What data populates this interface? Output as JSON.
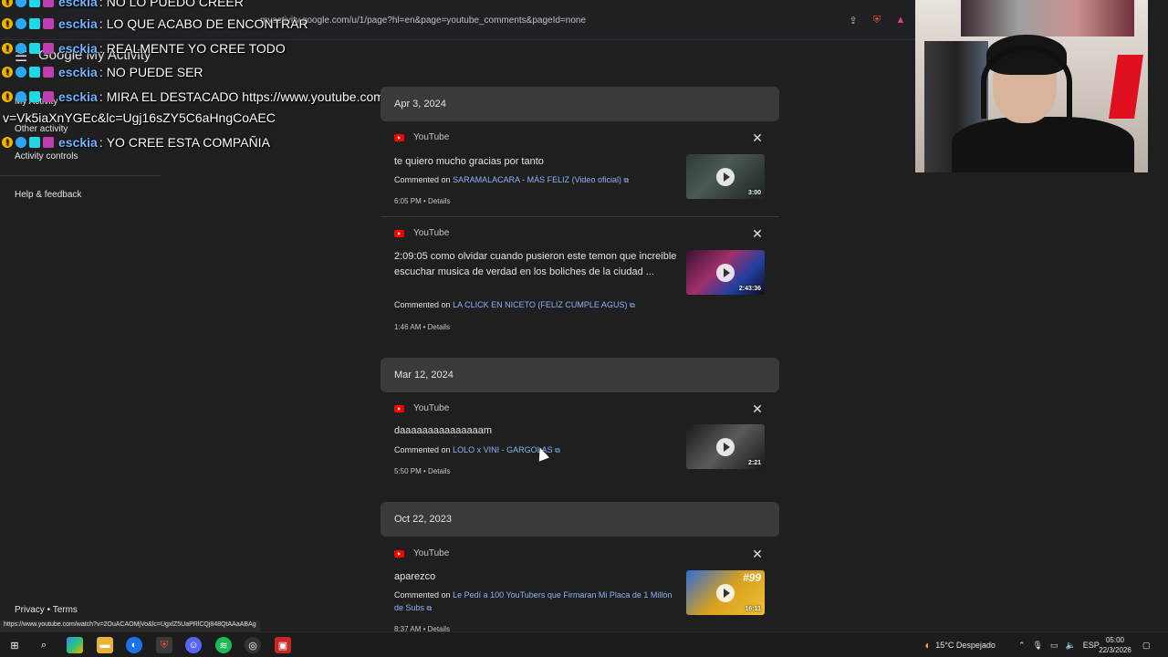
{
  "browser": {
    "url": "myactivity.google.com/u/1/page?hl=en&page=youtube_comments&pageId=none",
    "status_url": "https://www.youtube.com/watch?v=2OuACAOMjVo&lc=UgxlZ5UaPRlCQj848QtAAaABAg"
  },
  "app": {
    "title": "Google My Activity"
  },
  "sidebar": {
    "items": [
      {
        "label": "My Activity"
      },
      {
        "label": "Other activity"
      },
      {
        "label": "Activity controls"
      },
      {
        "label": "Help & feedback"
      }
    ],
    "footer": {
      "privacy": "Privacy",
      "sep": "•",
      "terms": "Terms"
    }
  },
  "chat": {
    "username": "esckia",
    "messages": [
      "NO LO PUEDO CREER",
      "LO QUE ACABO DE ENCONTRAR",
      "REALMENTE YO CREE TODO",
      "NO PUEDE SER",
      "MIRA EL DESTACADO https://www.youtube.com/watch?",
      "YO CREE ESTA COMPAÑIA"
    ],
    "continuation": "v=Vk5iaXnYGEc&lc=Ugj16sZY5C6aHngCoAEC"
  },
  "feed": {
    "groups": [
      {
        "date": "Apr 3, 2024",
        "items": [
          {
            "source": "YouTube",
            "text": "te quiero mucho gracias por tanto",
            "prefix": "Commented on",
            "video": "SARAMALACARA - MÁS FELIZ (Video oficial)",
            "meta": "6:05 PM • Details",
            "duration": "3:00"
          },
          {
            "source": "YouTube",
            "text": "2:09:05 como olvidar cuando pusieron este temon que in­creible escuchar musica de verdad en los boliches de la ciu­dad ...",
            "prefix": "Commented on",
            "video": "LA CLICK EN NICETO (FELIZ CUMPLE AGUS)",
            "meta": "1:46 AM • Details",
            "duration": "2:43:36"
          }
        ]
      },
      {
        "date": "Mar 12, 2024",
        "items": [
          {
            "source": "YouTube",
            "text": "daaaaaaaaaaaaaaam",
            "prefix": "Commented on",
            "video": "LOLO x VINI - GARGOLAS",
            "meta": "5:50 PM • Details",
            "duration": "2:21"
          }
        ]
      },
      {
        "date": "Oct 22, 2023",
        "items": [
          {
            "source": "YouTube",
            "text": "aparezco",
            "prefix": "Commented on",
            "video": "Le Pedí a 100 YouTubers que Firmaran Mi Placa de 1 Millón de Subs",
            "meta": "8:37 AM • Details",
            "duration": "16:11",
            "thumb_text": "#99"
          }
        ]
      }
    ]
  },
  "taskbar": {
    "weather": "15°C Despejado",
    "lang": "ESP",
    "time": "05:00",
    "date": "22/3/2026"
  },
  "colors": {
    "background": "#1f1f1f",
    "date_header": "#393a3c",
    "link": "#8ab4f8",
    "youtube_red": "#ff0000"
  }
}
